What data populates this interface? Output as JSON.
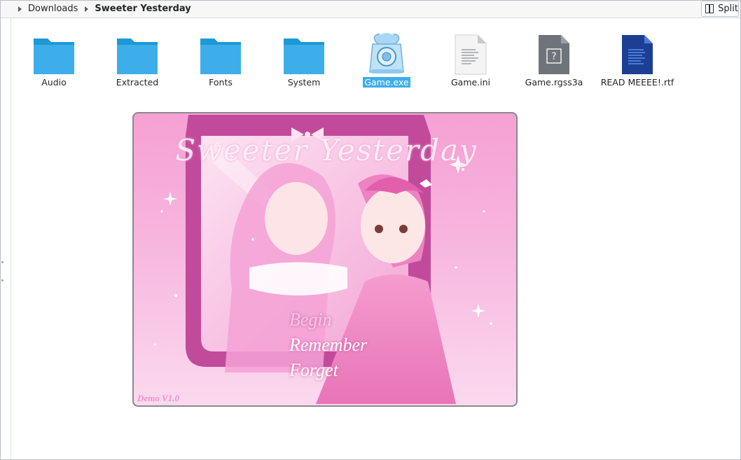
{
  "breadcrumb": {
    "items": [
      {
        "label": "Downloads",
        "current": false
      },
      {
        "label": "Sweeter Yesterday",
        "current": true
      }
    ]
  },
  "toolbar": {
    "split_label": "Split"
  },
  "files": [
    {
      "name": "Audio",
      "type": "folder",
      "icon": "folder-icon",
      "selected": false
    },
    {
      "name": "Extracted",
      "type": "folder",
      "icon": "folder-icon",
      "selected": false
    },
    {
      "name": "Fonts",
      "type": "folder",
      "icon": "folder-icon",
      "selected": false
    },
    {
      "name": "System",
      "type": "folder",
      "icon": "folder-icon",
      "selected": false
    },
    {
      "name": "Game.exe",
      "type": "exe",
      "icon": "telephone-icon",
      "selected": true
    },
    {
      "name": "Game.ini",
      "type": "text",
      "icon": "text-file-icon",
      "selected": false
    },
    {
      "name": "Game.rgss3a",
      "type": "unknown",
      "icon": "unknown-file-icon",
      "selected": false
    },
    {
      "name": "READ MEEEE!.rtf",
      "type": "rtf",
      "icon": "document-icon",
      "selected": false
    }
  ],
  "game_preview": {
    "title": "Sweeter Yesterday",
    "menu": [
      "Begin",
      "Remember",
      "Forget"
    ],
    "version": "Demo V1.0"
  },
  "colors": {
    "folder": "#3daee9",
    "selection": "#3daee9",
    "game_pink": "#f7b6df"
  }
}
